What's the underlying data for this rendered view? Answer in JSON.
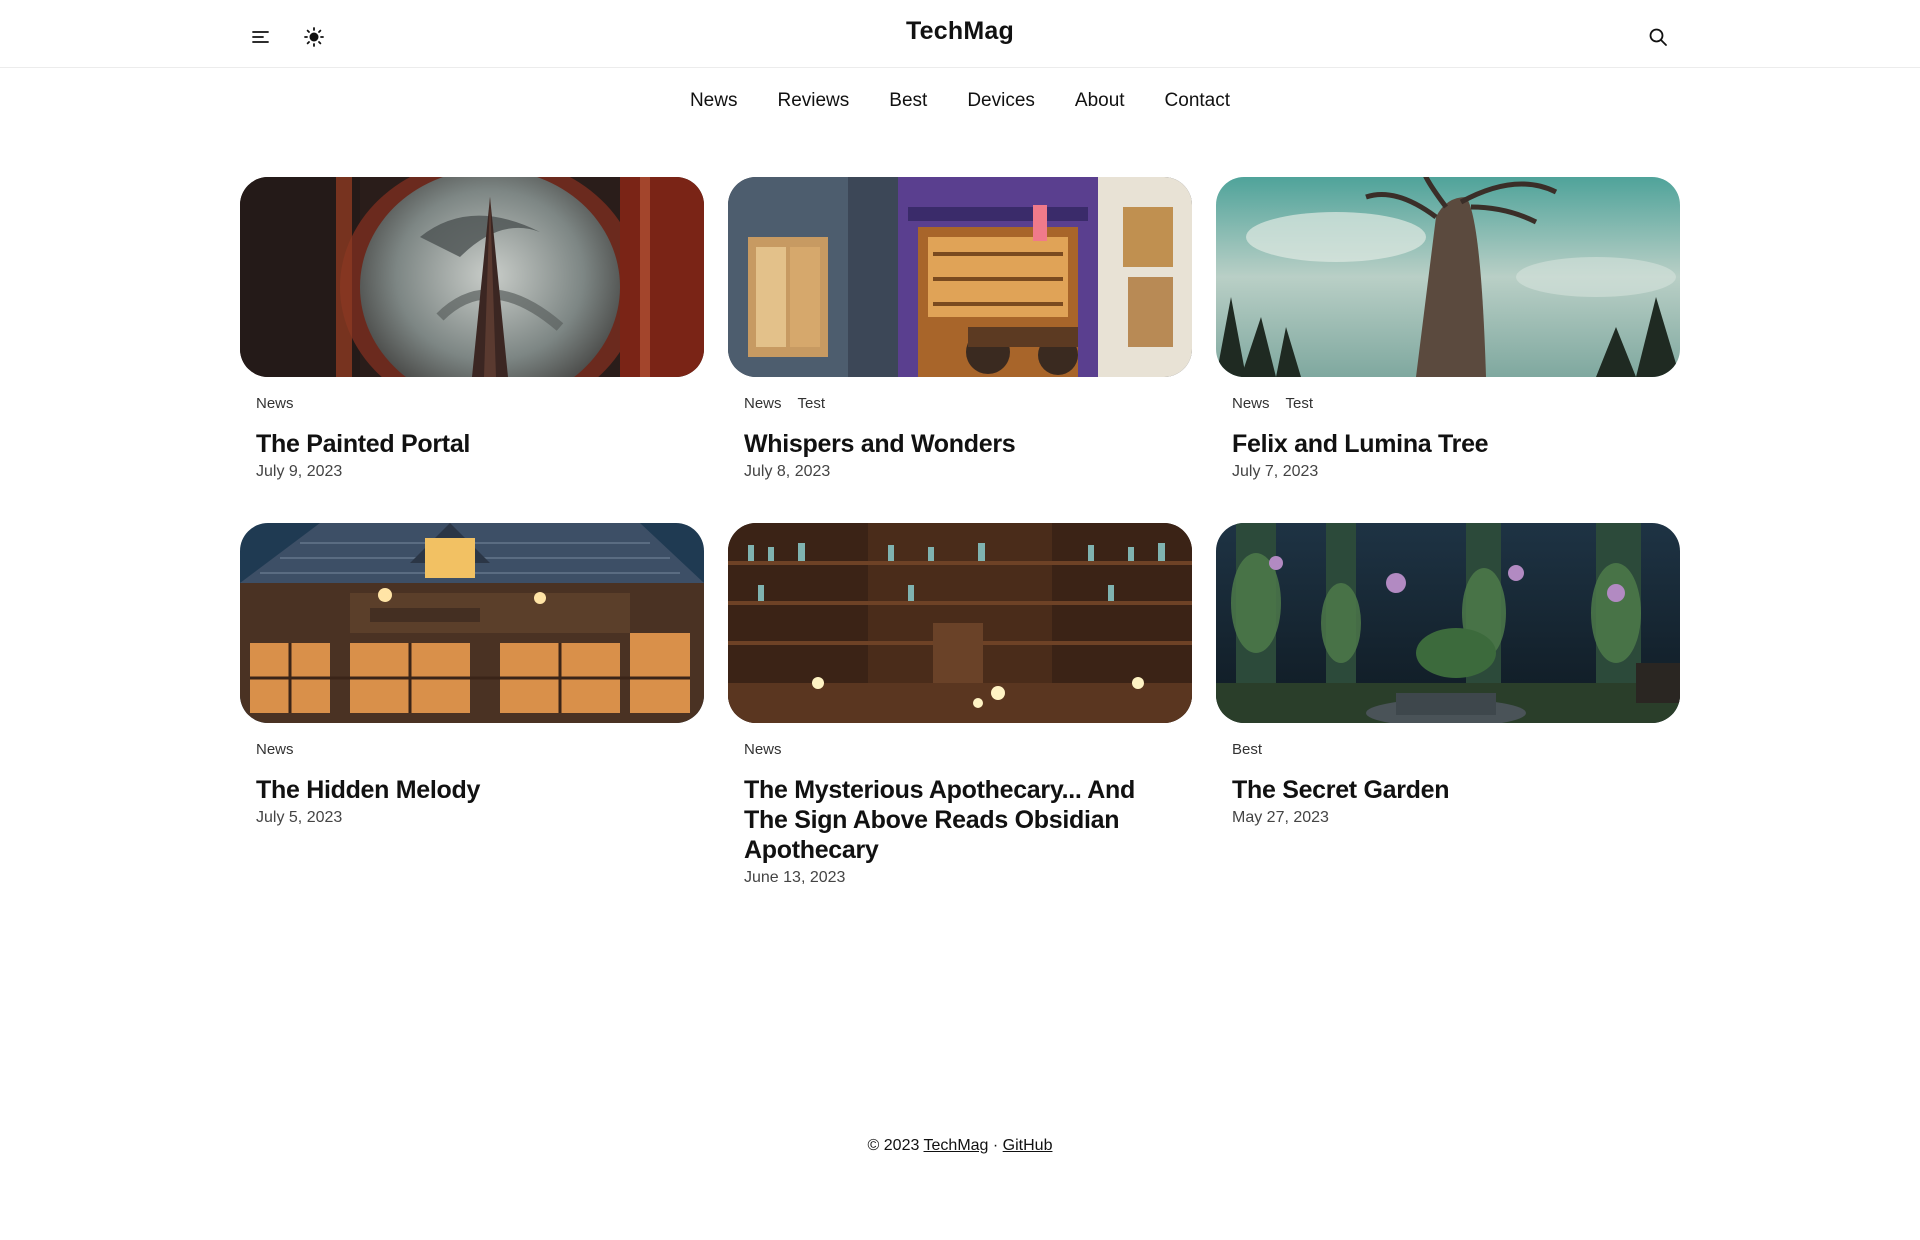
{
  "header": {
    "site_title": "TechMag",
    "menu_icon": "menu-icon",
    "theme_icon": "sun-icon",
    "search_icon": "search-icon"
  },
  "nav": {
    "items": [
      "News",
      "Reviews",
      "Best",
      "Devices",
      "About",
      "Contact"
    ]
  },
  "posts": [
    {
      "tags": [
        "News"
      ],
      "title": "The Painted Portal",
      "date": "July 9, 2023"
    },
    {
      "tags": [
        "News",
        "Test"
      ],
      "title": "Whispers and Wonders",
      "date": "July 8, 2023"
    },
    {
      "tags": [
        "News",
        "Test"
      ],
      "title": "Felix and Lumina Tree",
      "date": "July 7, 2023"
    },
    {
      "tags": [
        "News"
      ],
      "title": "The Hidden Melody",
      "date": "July 5, 2023"
    },
    {
      "tags": [
        "News"
      ],
      "title": "The Mysterious Apothecary... And The Sign Above Reads Obsidian Apothecary",
      "date": "June 13, 2023"
    },
    {
      "tags": [
        "Best"
      ],
      "title": "The Secret Garden",
      "date": "May 27, 2023"
    }
  ],
  "footer": {
    "copyright": "© 2023",
    "site_link": "TechMag",
    "separator": "·",
    "github_link": "GitHub"
  },
  "colors": {
    "text": "#111111",
    "border": "#ececec"
  }
}
